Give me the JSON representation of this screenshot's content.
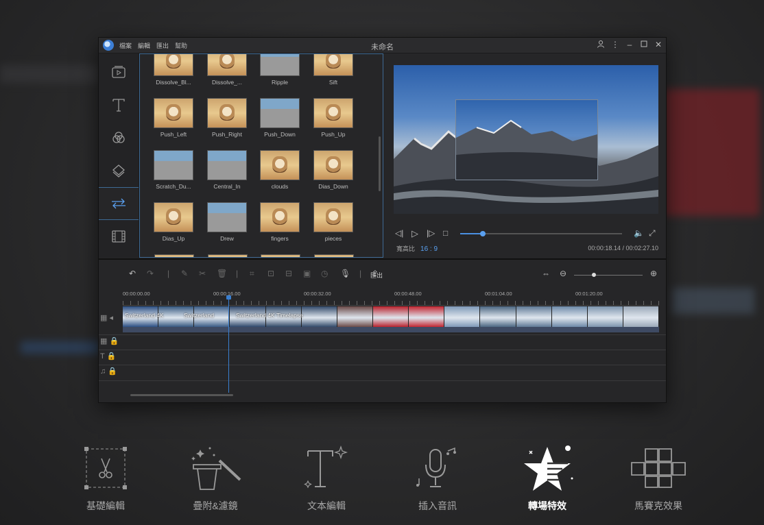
{
  "window": {
    "title": "未命名",
    "menu": [
      "檔案",
      "編輯",
      "匯出",
      "幫助"
    ]
  },
  "transitions": [
    {
      "label": "Dissolve_Bl..."
    },
    {
      "label": "Dissolve_..."
    },
    {
      "label": "Ripple"
    },
    {
      "label": "Sift"
    },
    {
      "label": "Push_Left"
    },
    {
      "label": "Push_Right"
    },
    {
      "label": "Push_Down"
    },
    {
      "label": "Push_Up"
    },
    {
      "label": "Scratch_Du..."
    },
    {
      "label": "Central_In"
    },
    {
      "label": "clouds"
    },
    {
      "label": "Dias_Down"
    },
    {
      "label": "Dias_Up"
    },
    {
      "label": "Drew"
    },
    {
      "label": "fingers"
    },
    {
      "label": "pieces"
    }
  ],
  "preview": {
    "aspect_label": "寬高比",
    "aspect_value": "16 : 9",
    "timecode": "00:00:18.14 / 00:02:27.10",
    "progress": 0.14
  },
  "toolbar": {
    "export_label": "匯出"
  },
  "timeline": {
    "ruler": [
      "00:00:00.00",
      "00:00:16.00",
      "00:00:32.00",
      "00:00:48.00",
      "00:01:04.00",
      "00:01:20.00"
    ],
    "clip_titles": [
      "Switzerland 4K",
      "Switzerland",
      "Switzerland 4K Timelapse"
    ]
  },
  "features": [
    {
      "label": "基礎編輯",
      "icon": "scissors-icon"
    },
    {
      "label": "疊附&濾鏡",
      "icon": "magic-hat-icon"
    },
    {
      "label": "文本編輯",
      "icon": "text-icon"
    },
    {
      "label": "插入音訊",
      "icon": "microphone-icon"
    },
    {
      "label": "轉場特效",
      "icon": "star-icon",
      "active": true
    },
    {
      "label": "馬賽克效果",
      "icon": "mosaic-icon"
    }
  ],
  "colors": {
    "accent": "#4a90e2",
    "panel_border": "#3e6a95",
    "background": "#2a2a2b"
  }
}
